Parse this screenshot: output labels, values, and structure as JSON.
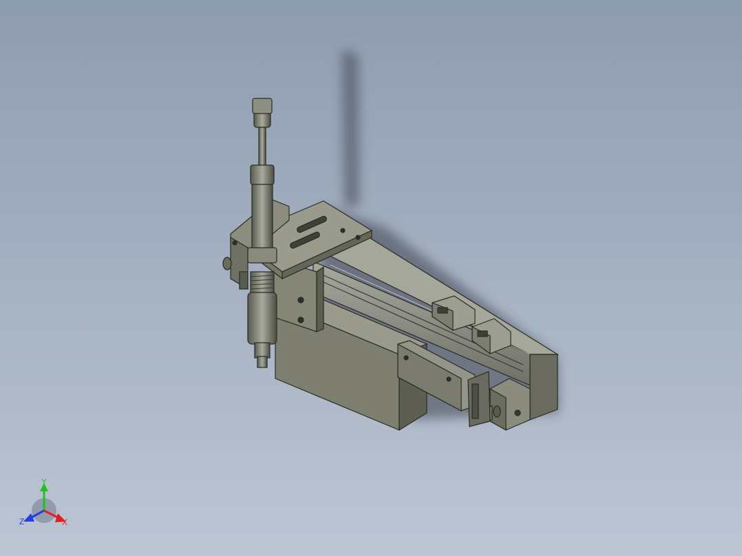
{
  "viewport": {
    "background_top": "#8e9cb0",
    "background_bottom": "#bcc5d3"
  },
  "model": {
    "body_color": "#8a8c7a",
    "body_dark": "#5e5f52",
    "edge_color": "#2a2a24",
    "rail_color": "#9c9d92"
  },
  "triad": {
    "x_label": "X",
    "y_label": "Y",
    "z_label": "Z",
    "x_color": "#e02020",
    "y_color": "#20c020",
    "z_color": "#2040e0"
  }
}
